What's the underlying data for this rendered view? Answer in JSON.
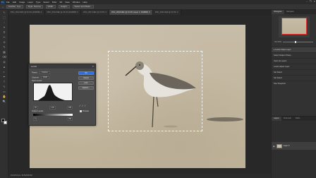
{
  "app": {
    "logo_text": "Ps",
    "menu": [
      "File",
      "Edit",
      "Image",
      "Layer",
      "Type",
      "Select",
      "Filter",
      "3D",
      "View",
      "Window",
      "Help"
    ],
    "window_controls": [
      "–",
      "❐",
      "✕"
    ]
  },
  "options_bar": {
    "tool_icon": "⌂",
    "fields": [
      "Feather: 0 px",
      "Style: Normal",
      "Width:",
      "Height:",
      "Select and Mask..."
    ]
  },
  "tabs": [
    {
      "label": "DSC_0012.NEF @ 33.3% (RGB/8#) ✕",
      "active": false
    },
    {
      "label": "DSC_0013.NEF @ 33.3% (RGB/8#) ✕",
      "active": false
    },
    {
      "label": "DSC_0017.NEF @ 33.3% ✕",
      "active": false
    },
    {
      "label": "DSC_0018.NEF @ 33.3% (Layer 0, RGB/8#) ✕",
      "active": true
    },
    {
      "label": "DSC_0021.NEF @ 33.3% ✕",
      "active": false
    }
  ],
  "status": "33.33%    Doc: 36.5M/36.5M",
  "tools": [
    "↖",
    "⬚",
    "◌",
    "⌖",
    "⌗",
    "✂",
    "⊘",
    "✎",
    "▦",
    "⌫",
    "◍",
    "▲",
    "◐",
    "✒",
    "T",
    "⇖",
    "▭",
    "✋",
    "🔍"
  ],
  "dialog": {
    "title": "Levels",
    "close": "✕",
    "preset_label": "Preset:",
    "preset_value": "Custom",
    "channel_label": "Channel:",
    "channel_value": "RGB",
    "input_label": "Input Levels:",
    "input_values": [
      "35",
      "1.00",
      "235"
    ],
    "output_label": "Output Levels:",
    "output_values": [
      "0",
      "255"
    ],
    "buttons": {
      "ok": "OK",
      "cancel": "Cancel",
      "auto": "Auto",
      "options": "Options..."
    },
    "droppers": [
      "⁄",
      "⁄",
      "⁄"
    ],
    "preview_label": "Preview"
  },
  "panels": {
    "tabs": [
      "Histogram",
      "Navigator"
    ],
    "zoom": "33.33%",
    "rows": [
      {
        "label": "▸ Levels Adjust Layer",
        "selected": true
      },
      {
        "label": "Select Subject Sharp...",
        "selected": false
      },
      {
        "label": "Open as Layers",
        "selected": false
      },
      {
        "label": "Levels Adjust Layer",
        "selected": false
      },
      {
        "label": "Set Select",
        "selected": false
      },
      {
        "label": "Set Select",
        "selected": false
      },
      {
        "label": "New Snapshot",
        "selected": false
      }
    ],
    "layers_tabs": [
      "Layers",
      "Channels",
      "Paths"
    ],
    "layer_name": "Layer 0"
  }
}
